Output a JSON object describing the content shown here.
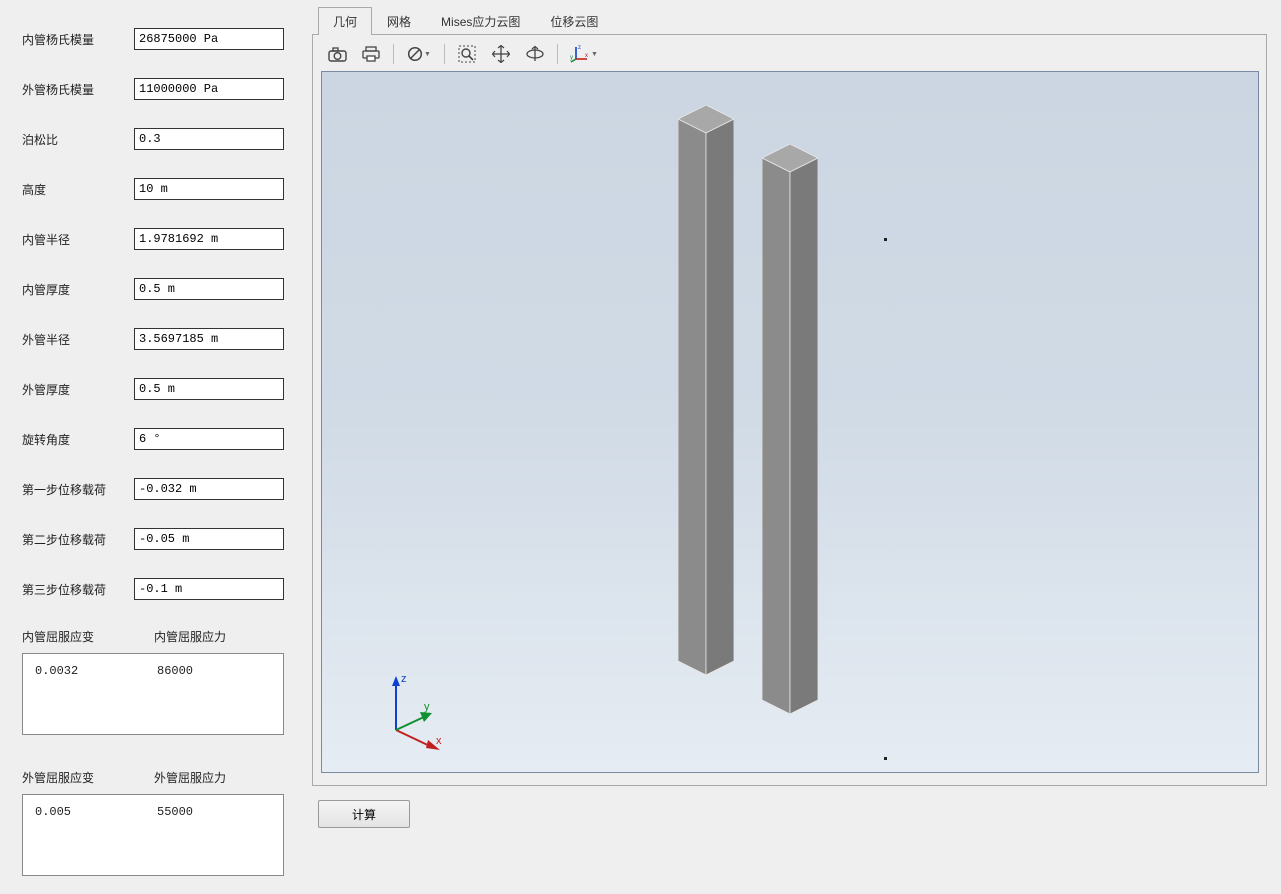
{
  "sidebar": {
    "fields": [
      {
        "label": "内管杨氏模量",
        "value": "26875000 Pa"
      },
      {
        "label": "外管杨氏模量",
        "value": "11000000 Pa"
      },
      {
        "label": "泊松比",
        "value": "0.3"
      },
      {
        "label": "高度",
        "value": "10 m"
      },
      {
        "label": "内管半径",
        "value": "1.9781692 m"
      },
      {
        "label": "内管厚度",
        "value": "0.5 m"
      },
      {
        "label": "外管半径",
        "value": "3.5697185 m"
      },
      {
        "label": "外管厚度",
        "value": "0.5 m"
      },
      {
        "label": "旋转角度",
        "value": "6 °"
      },
      {
        "label": "第一步位移载荷",
        "value": "-0.032 m"
      },
      {
        "label": "第二步位移载荷",
        "value": "-0.05 m"
      },
      {
        "label": "第三步位移载荷",
        "value": "-0.1 m"
      }
    ],
    "yield_inner": {
      "strain_label": "内管屈服应变",
      "stress_label": "内管屈服应力",
      "strain": "0.0032",
      "stress": "86000"
    },
    "yield_outer": {
      "strain_label": "外管屈服应变",
      "stress_label": "外管屈服应力",
      "strain": "0.005",
      "stress": "55000"
    }
  },
  "tabs": {
    "items": [
      {
        "label": "几何"
      },
      {
        "label": "网格"
      },
      {
        "label": "Mises应力云图"
      },
      {
        "label": "位移云图"
      }
    ],
    "active_index": 0
  },
  "toolbar": {
    "icons": [
      "camera-icon",
      "print-icon",
      "_sep",
      "no-entry-icon",
      "_sep",
      "zoom-box-icon",
      "pan-icon",
      "rotate-icon",
      "_sep",
      "axes-icon"
    ]
  },
  "viewport": {
    "axes": {
      "x": "x",
      "y": "y",
      "z": "z"
    }
  },
  "buttons": {
    "calculate": "计算"
  }
}
